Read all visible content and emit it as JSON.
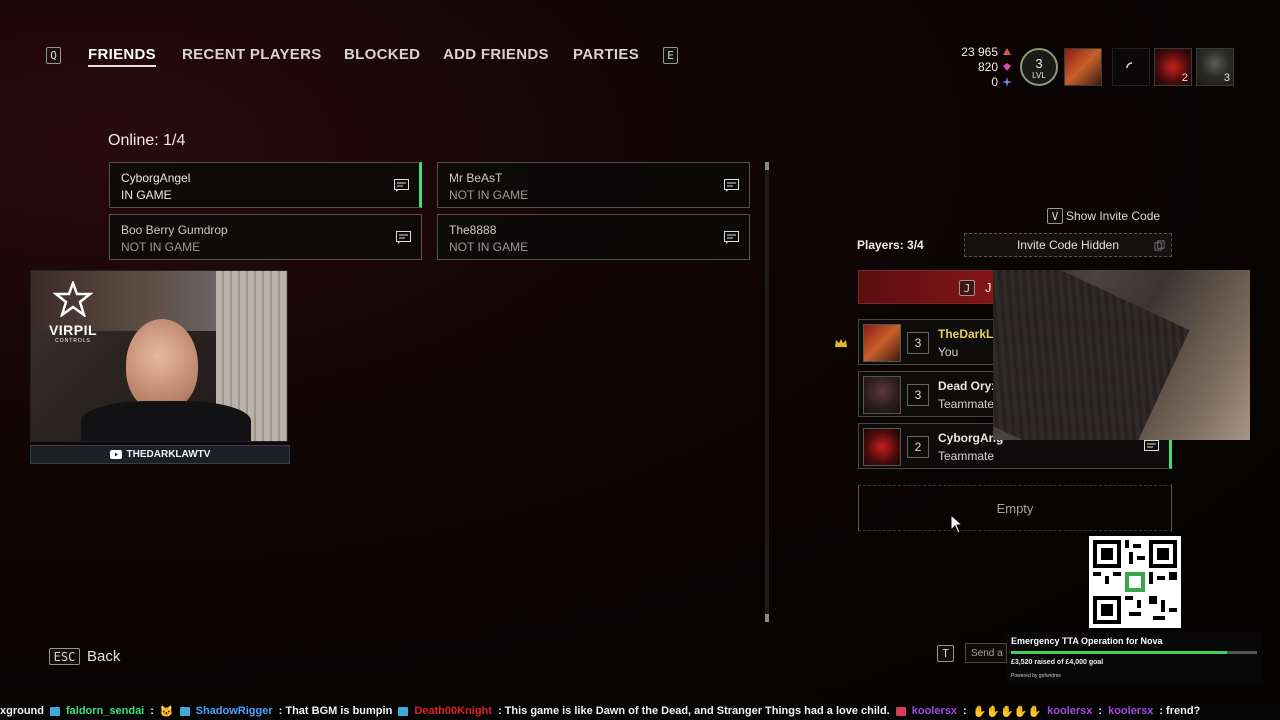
{
  "nav": {
    "left_key": "Q",
    "right_key": "E",
    "tabs": [
      {
        "label": "FRIENDS",
        "active": true
      },
      {
        "label": "RECENT PLAYERS",
        "active": false
      },
      {
        "label": "BLOCKED",
        "active": false
      },
      {
        "label": "ADD FRIENDS",
        "active": false
      },
      {
        "label": "PARTIES",
        "active": false
      }
    ]
  },
  "currencies": [
    {
      "value": "23 965",
      "color": "#c8623a"
    },
    {
      "value": "820",
      "color": "#d34fa6"
    },
    {
      "value": "0",
      "color": "#7a8cf0"
    }
  ],
  "player_level": {
    "value": "3",
    "label": "LVL"
  },
  "party_thumbs": [
    {
      "badge": ""
    },
    {
      "badge": ""
    },
    {
      "badge": "2"
    },
    {
      "badge": "3"
    }
  ],
  "friends": {
    "online_label": "Online: 1/4",
    "list": [
      {
        "name": "CyborgAngel",
        "status": "IN GAME",
        "online": true
      },
      {
        "name": "Mr BeAsT",
        "status": "NOT IN GAME",
        "online": false
      },
      {
        "name": "Boo Berry Gumdrop",
        "status": "NOT IN GAME",
        "online": false
      },
      {
        "name": "The8888",
        "status": "NOT IN GAME",
        "online": false
      }
    ]
  },
  "stream": {
    "brand": "VIRPIL",
    "brand_sub": "CONTROLS",
    "channel": "THEDARKLAWTV"
  },
  "party": {
    "show_invite_key": "V",
    "show_invite_label": "Show Invite Code",
    "players_label": "Players: 3/4",
    "invite_code_label": "Invite Code Hidden",
    "join_key": "J",
    "join_label": "J",
    "members": [
      {
        "level": "3",
        "name": "TheDarkLa",
        "role": "You",
        "leader": true
      },
      {
        "level": "3",
        "name": "Dead Oryx",
        "role": "Teammate",
        "leader": false
      },
      {
        "level": "2",
        "name": "CyborgAng",
        "role": "Teammate",
        "leader": false
      }
    ],
    "empty_label": "Empty",
    "send_key": "T",
    "send_label": "Send a"
  },
  "footer": {
    "back_key": "ESC",
    "back_label": "Back"
  },
  "donation": {
    "title": "Emergency TTA Operation for Nova",
    "raised": "£3,520 raised of £4,000 goal",
    "powered": "Powered by gofundme",
    "progress": 0.88
  },
  "chat": [
    {
      "user": "xground",
      "color": "#f2f2f2",
      "msg": ""
    },
    {
      "user": "faldorn_sendai",
      "color": "#3fe07a",
      "msg": ":"
    },
    {
      "user": "ShadowRigger",
      "color": "#4aa3ff",
      "msg": ": That BGM is bumpin"
    },
    {
      "user": "Death00Knight",
      "color": "#e02020",
      "msg": ": This game is like Dawn of the Dead, and Stranger Things had a love child."
    },
    {
      "user": "koolersx",
      "color": "#a04ad8",
      "msg": ":"
    },
    {
      "user": "koolersx",
      "color": "#a04ad8",
      "msg": ":"
    },
    {
      "user": "koolersx",
      "color": "#a04ad8",
      "msg": ": frend?"
    }
  ]
}
